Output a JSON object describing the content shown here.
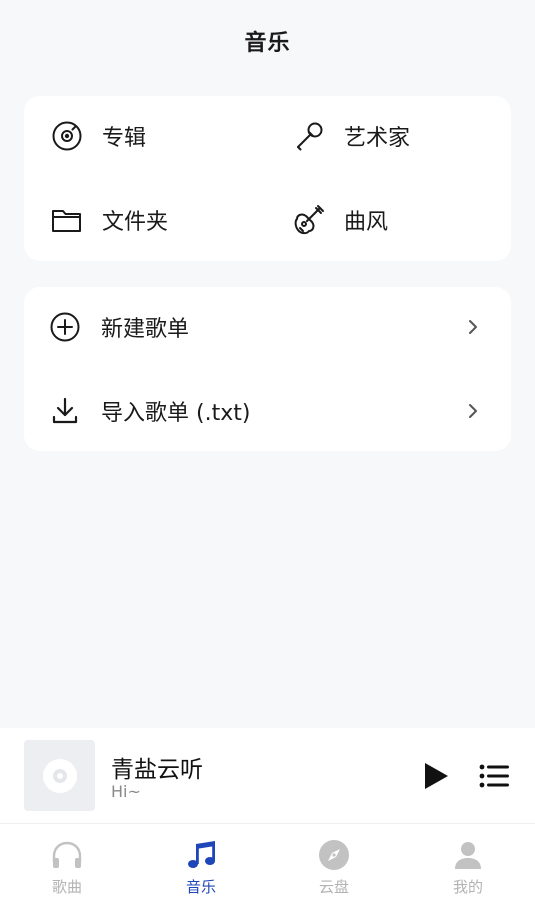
{
  "header": {
    "title": "音乐"
  },
  "grid": [
    {
      "label": "专辑",
      "icon": "album-icon"
    },
    {
      "label": "艺术家",
      "icon": "microphone-icon"
    },
    {
      "label": "文件夹",
      "icon": "folder-icon"
    },
    {
      "label": "曲风",
      "icon": "guitar-icon"
    }
  ],
  "list": [
    {
      "label": "新建歌单",
      "icon": "plus-circle-icon"
    },
    {
      "label": "导入歌单 (.txt)",
      "icon": "download-icon"
    }
  ],
  "player": {
    "title": "青盐云听",
    "subtitle": "Hi~"
  },
  "tabs": [
    {
      "label": "歌曲",
      "icon": "headphones-icon"
    },
    {
      "label": "音乐",
      "icon": "music-note-icon"
    },
    {
      "label": "云盘",
      "icon": "compass-icon"
    },
    {
      "label": "我的",
      "icon": "user-icon"
    }
  ],
  "colors": {
    "accent": "#1f46b8",
    "inactive": "#b3b3b3",
    "background": "#f7f8fa",
    "card": "#ffffff"
  }
}
